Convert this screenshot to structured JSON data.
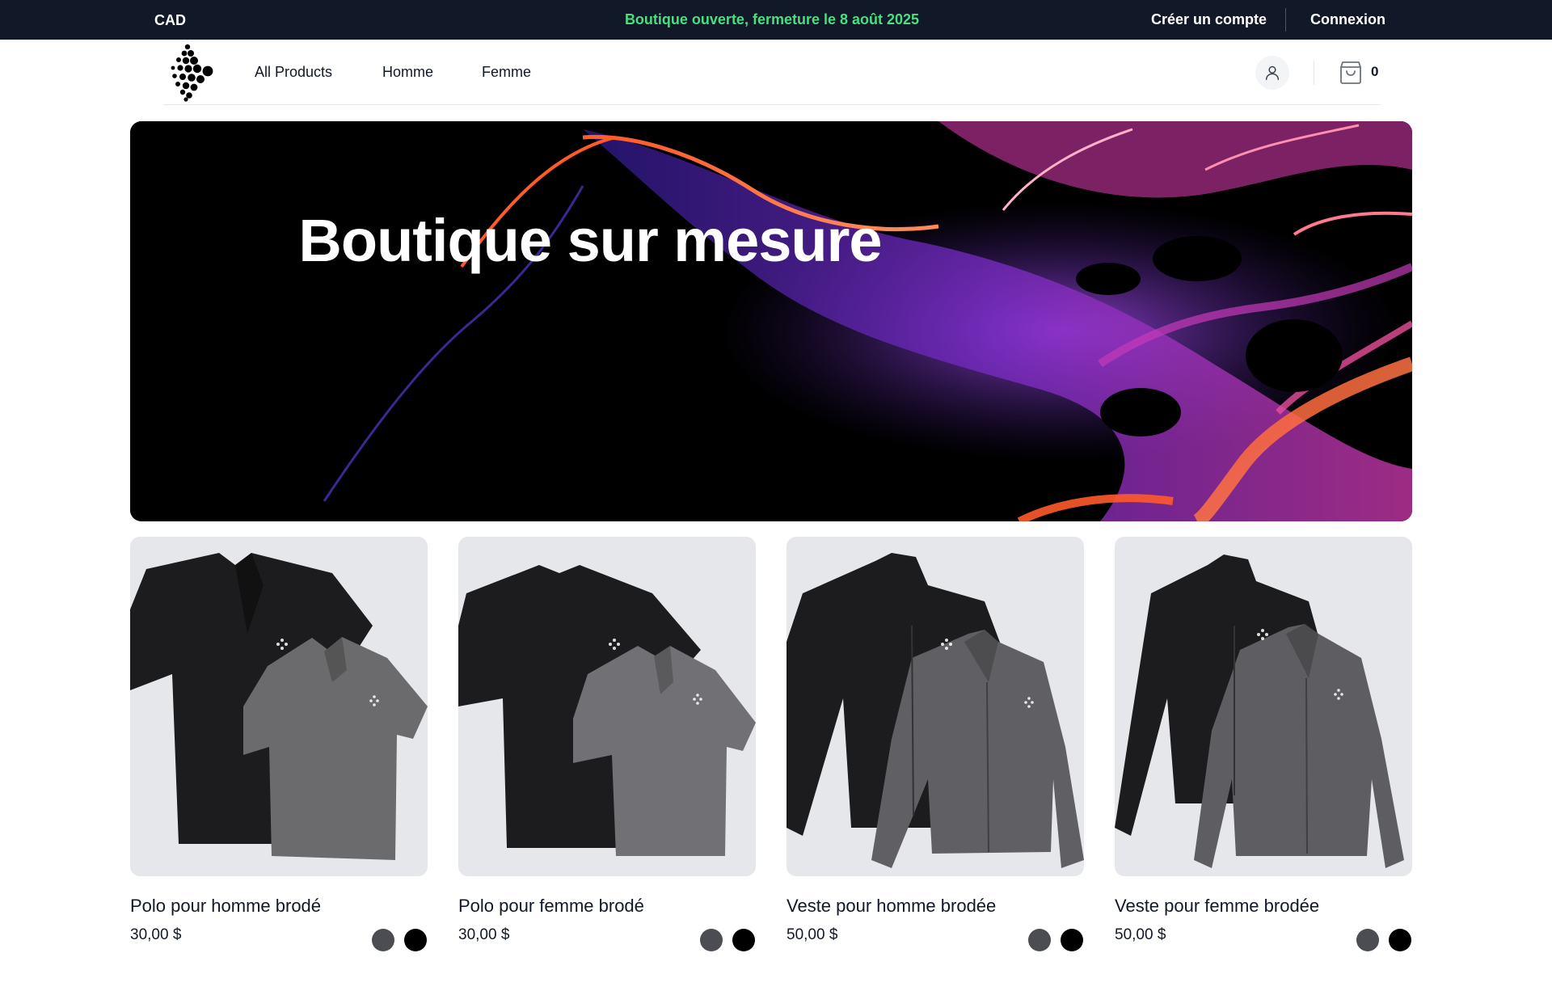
{
  "topbar": {
    "currency": "CAD",
    "announcement": "Boutique ouverte, fermeture le 8 août 2025",
    "create_account": "Créer un compte",
    "login": "Connexion",
    "announcement_color": "#4ade80",
    "background": "#111827"
  },
  "header": {
    "logo_icon": "dotted-diamond-logo",
    "nav": [
      {
        "label": "All Products"
      },
      {
        "label": "Homme"
      },
      {
        "label": "Femme"
      }
    ],
    "user_icon": "user-icon",
    "cart_icon": "shopping-bag-icon",
    "cart_count": "0"
  },
  "hero": {
    "title": "Boutique sur mesure"
  },
  "products": [
    {
      "name": "Polo pour homme brodé",
      "price": "30,00 $",
      "swatches": [
        "#4b4d52",
        "#000000"
      ]
    },
    {
      "name": "Polo pour femme brodé",
      "price": "30,00 $",
      "swatches": [
        "#4b4d52",
        "#000000"
      ]
    },
    {
      "name": "Veste pour homme brodée",
      "price": "50,00 $",
      "swatches": [
        "#4b4d52",
        "#000000"
      ]
    },
    {
      "name": "Veste pour femme brodée",
      "price": "50,00 $",
      "swatches": [
        "#4b4d52",
        "#000000"
      ]
    }
  ]
}
